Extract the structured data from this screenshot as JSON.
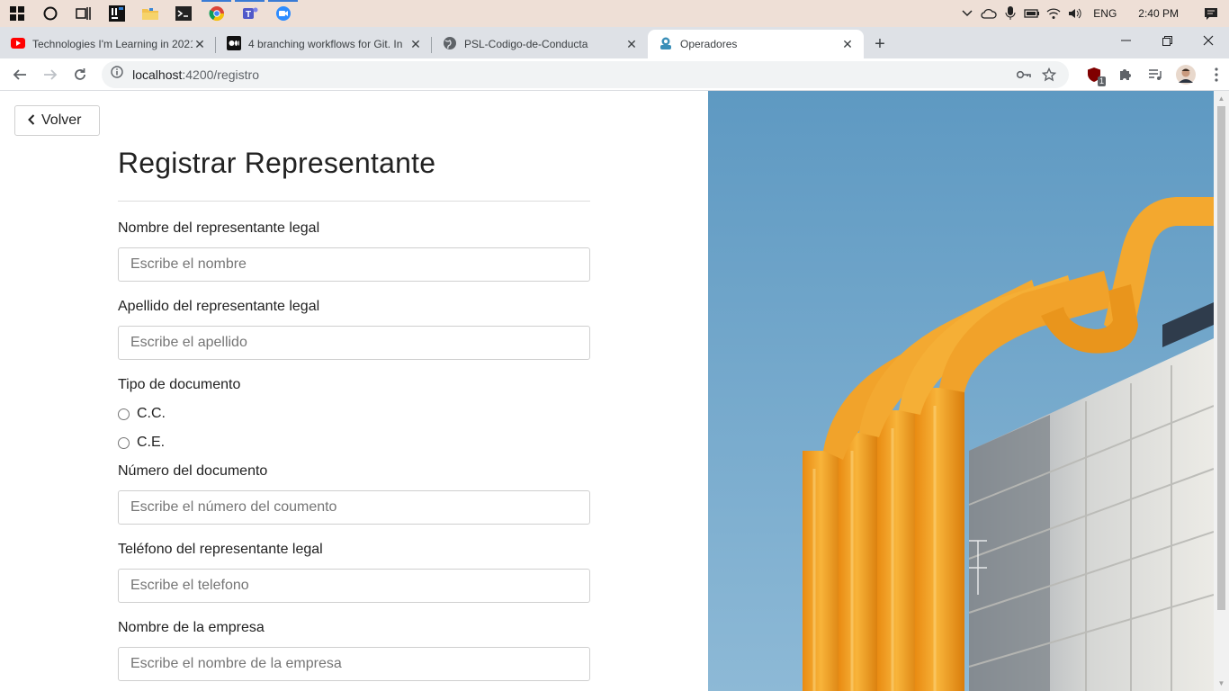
{
  "taskbar": {
    "apps": [
      {
        "name": "windows-start"
      },
      {
        "name": "cortana"
      },
      {
        "name": "task-view"
      },
      {
        "name": "intellij"
      },
      {
        "name": "file-explorer"
      },
      {
        "name": "terminal"
      },
      {
        "name": "chrome"
      },
      {
        "name": "teams"
      },
      {
        "name": "zoom"
      }
    ],
    "language": "ENG",
    "time": "2:40 PM"
  },
  "tabs": [
    {
      "title": "Technologies I'm Learning in 2021",
      "icon": "youtube-icon",
      "active": false
    },
    {
      "title": "4 branching workflows for Git. In",
      "icon": "medium-icon",
      "active": false
    },
    {
      "title": "PSL-Codigo-de-Conducta",
      "icon": "globe-icon",
      "active": false
    },
    {
      "title": "Operadores",
      "icon": "app-icon",
      "active": true
    }
  ],
  "toolbar": {
    "url_host": "localhost",
    "url_rest": ":4200/registro",
    "extension_badge": "1"
  },
  "page": {
    "back_label": "Volver",
    "title": "Registrar Representante",
    "fields": {
      "nombre_label": "Nombre del representante legal",
      "nombre_placeholder": "Escribe el nombre",
      "apellido_label": "Apellido del representante legal",
      "apellido_placeholder": "Escribe el apellido",
      "tipo_label": "Tipo de documento",
      "tipo_options": [
        "C.C.",
        "C.E."
      ],
      "numero_label": "Número del documento",
      "numero_placeholder": "Escribe el número del coumento",
      "telefono_label": "Teléfono del representante legal",
      "telefono_placeholder": "Escribe el telefono",
      "empresa_label": "Nombre de la empresa",
      "empresa_placeholder": "Escribe el nombre de la empresa"
    }
  },
  "colors": {
    "taskbar_bg": "#eedfd6",
    "tabstrip_bg": "#dee1e6",
    "sky": "#5f9cc4",
    "pipe": "#f3a226"
  }
}
